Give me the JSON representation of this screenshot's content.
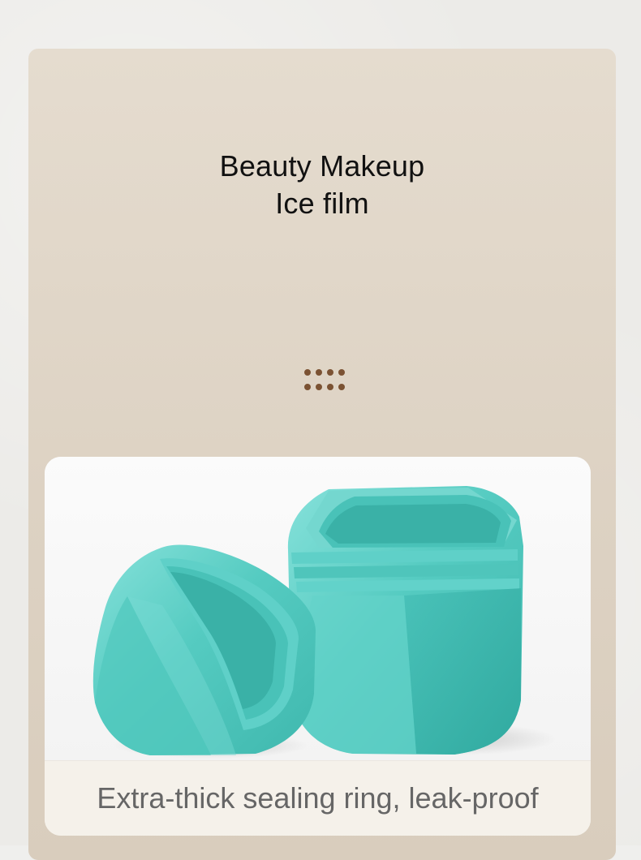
{
  "header": {
    "title_line_1": "Beauty Makeup",
    "title_line_2": "Ice film"
  },
  "decorations": {
    "dot_pattern": "brown-dot-grid",
    "dot_color": "#7b5233"
  },
  "product_image": {
    "subject": "teal silicone ice container",
    "color": "#5fd0c8"
  },
  "caption": {
    "text": "Extra-thick sealing ring, leak-proof"
  },
  "colors": {
    "page_background": "#ecebe8",
    "card_background": "#e2d8ca",
    "title_text": "#111111",
    "caption_text": "#666666"
  }
}
